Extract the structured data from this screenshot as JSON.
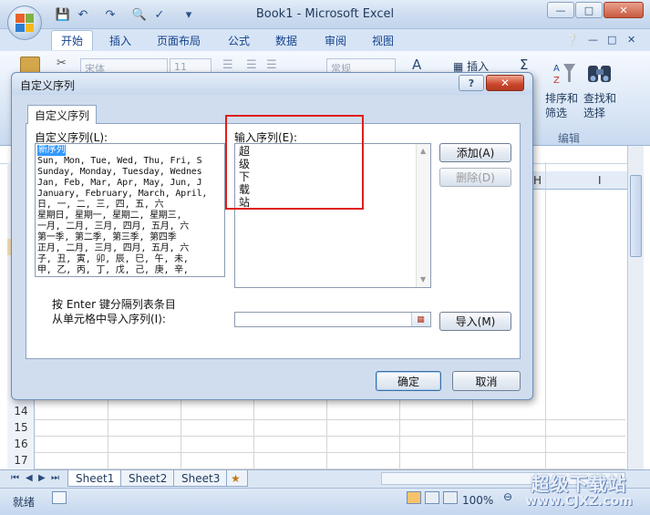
{
  "window": {
    "title": "Book1 - Microsoft Excel",
    "minimize": "—",
    "maximize": "□",
    "close": "✕"
  },
  "ribbon": {
    "tabs": [
      {
        "label": "开始",
        "active": true
      },
      {
        "label": "插入"
      },
      {
        "label": "页面布局"
      },
      {
        "label": "公式"
      },
      {
        "label": "数据"
      },
      {
        "label": "审阅"
      },
      {
        "label": "视图"
      }
    ],
    "font_name": "宋体",
    "font_size": "11",
    "number_format": "常规",
    "insert_label": "插入",
    "sort_filter": "排序和\n筛选",
    "find_select": "查找和\n选择",
    "editing_group": "编辑"
  },
  "sheet": {
    "column_headers": [
      "H",
      "I"
    ],
    "row_numbers": [
      "14",
      "15",
      "16",
      "17"
    ],
    "tabs": [
      "Sheet1",
      "Sheet2",
      "Sheet3"
    ]
  },
  "status": {
    "ready": "就绪",
    "zoom": "100%"
  },
  "watermark": {
    "title": "超级下载站",
    "url": "www.CJXZ.com"
  },
  "dialog": {
    "title": "自定义序列",
    "help": "?",
    "close": "✕",
    "tab_label": "自定义序列",
    "list_label": "自定义序列(L):",
    "list_items": [
      "新序列",
      "Sun, Mon, Tue, Wed, Thu, Fri, S",
      "Sunday, Monday, Tuesday, Wednes",
      "Jan, Feb, Mar, Apr, May, Jun, J",
      "January, February, March, April,",
      "日, 一, 二, 三, 四, 五, 六",
      "星期日, 星期一, 星期二, 星期三,",
      "一月, 二月, 三月, 四月, 五月, 六",
      "第一季, 第二季, 第三季, 第四季",
      "正月, 二月, 三月, 四月, 五月, 六",
      "子, 丑, 寅, 卯, 辰, 巳, 午, 未,",
      "甲, 乙, 丙, 丁, 戊, 己, 庚, 辛,"
    ],
    "entries_label": "输入序列(E):",
    "entries_text": "超\n级\n下\n载\n站",
    "add_button": "添加(A)",
    "delete_button": "删除(D)",
    "hint": "按 Enter 键分隔列表条目",
    "import_label": "从单元格中导入序列(I):",
    "import_button": "导入(M)",
    "ok_button": "确定",
    "cancel_button": "取消"
  }
}
